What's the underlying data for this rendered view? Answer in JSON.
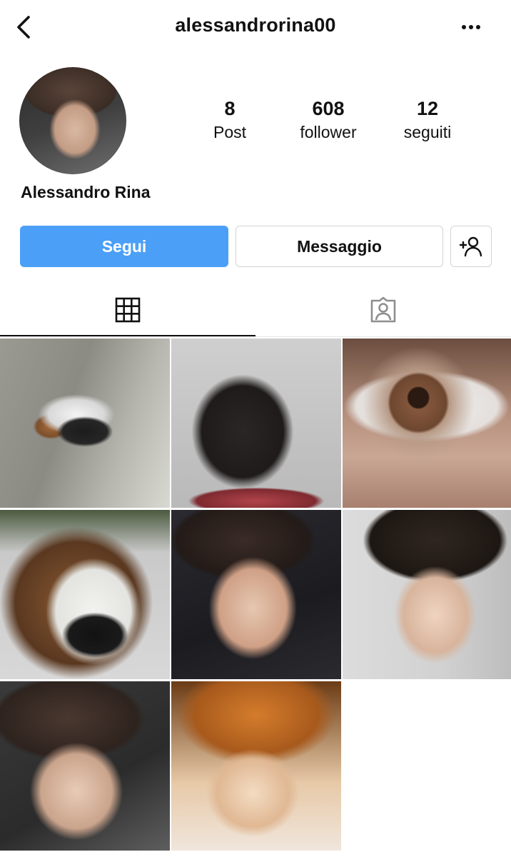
{
  "header": {
    "username": "alessandrorina00",
    "back_icon": "chevron-left-icon",
    "more_icon": "more-horizontal-icon"
  },
  "profile": {
    "full_name": "Alessandro Rina",
    "stats": [
      {
        "value": "8",
        "label": "Post"
      },
      {
        "value": "608",
        "label": "follower"
      },
      {
        "value": "12",
        "label": "seguiti"
      }
    ]
  },
  "actions": {
    "follow_label": "Segui",
    "message_label": "Messaggio",
    "add_icon": "add-person-icon",
    "follow_color": "#4b9ff7"
  },
  "tabs": [
    {
      "icon": "grid-icon",
      "active": true
    },
    {
      "icon": "tagged-person-icon",
      "active": false
    }
  ],
  "posts": [
    {
      "subject": "dog and black cat"
    },
    {
      "subject": "black cat"
    },
    {
      "subject": "eye close-up"
    },
    {
      "subject": "dog nose close-up"
    },
    {
      "subject": "smiling face selfie"
    },
    {
      "subject": "profile selfie"
    },
    {
      "subject": "selfie"
    },
    {
      "subject": "selfie orange light"
    }
  ]
}
